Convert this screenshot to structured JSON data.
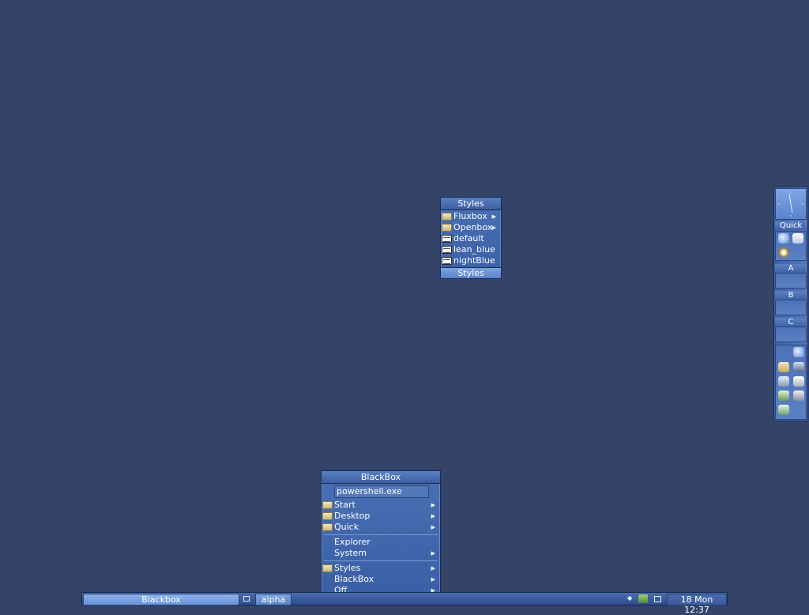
{
  "styles_menu": {
    "title": "Styles",
    "items": [
      {
        "label": "Fluxbox",
        "icon": "folder-icon",
        "submenu": true
      },
      {
        "label": "Openbox",
        "icon": "folder-icon",
        "submenu": true
      },
      {
        "label": "default",
        "icon": "style-file-icon",
        "submenu": false
      },
      {
        "label": "lean_blue",
        "icon": "style-file-icon",
        "submenu": false
      },
      {
        "label": "nightBlue",
        "icon": "style-file-icon",
        "submenu": false
      }
    ],
    "footer": "Styles"
  },
  "root_menu": {
    "title": "BlackBox",
    "command_value": "powershell.exe",
    "items": {
      "start": "Start",
      "desktop": "Desktop",
      "quick": "Quick",
      "explorer": "Explorer",
      "system": "System",
      "styles": "Styles",
      "blackbox": "BlackBox",
      "off": "Off"
    }
  },
  "taskbar": {
    "task_label": "Blackbox",
    "workspace": "alpha",
    "clock": "18 Mon 12:37"
  },
  "slit": {
    "quick_label": "Quick",
    "panel_a": "A",
    "panel_b": "B",
    "panel_c": "C"
  },
  "colors": {
    "desktop": "#344468",
    "menu": "#4a6fb4",
    "highlight": "#7ea4e2"
  }
}
